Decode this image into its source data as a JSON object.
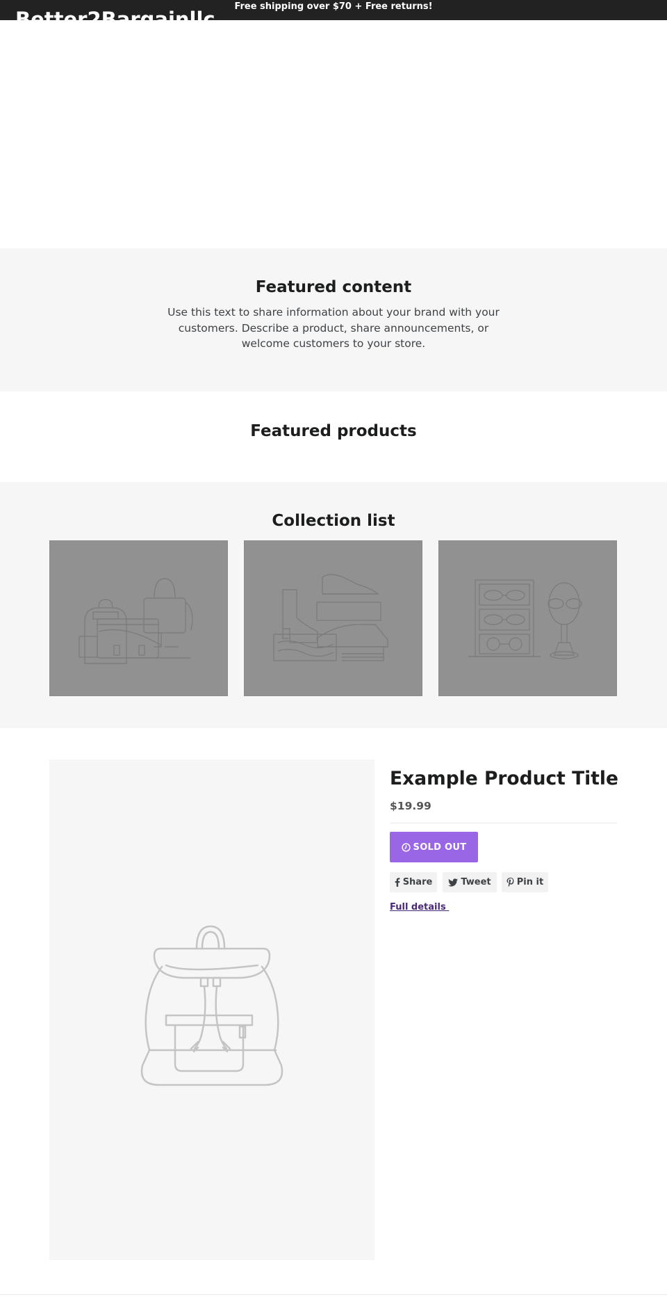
{
  "announcement": {
    "text": "Free shipping over $70 + Free returns!"
  },
  "header": {
    "logo": "Better2Bargainllc"
  },
  "featured_content": {
    "title": "Featured content",
    "body": "Use this text to share information about your brand with your customers. Describe a product, share announcements, or welcome customers to your store."
  },
  "featured_products": {
    "title": "Featured products"
  },
  "collection_list": {
    "title": "Collection list",
    "items": [
      {
        "icon": "bags-collection-icon"
      },
      {
        "icon": "shoes-collection-icon"
      },
      {
        "icon": "glasses-collection-icon"
      }
    ]
  },
  "product": {
    "image_icon": "backpack-icon",
    "title": "Example Product Title",
    "price": "$19.99",
    "sold_out_label": "SOLD OUT",
    "share_buttons": [
      {
        "label": "Share",
        "icon": "facebook-icon"
      },
      {
        "label": "Tweet",
        "icon": "twitter-icon"
      },
      {
        "label": "Pin it",
        "icon": "pinterest-icon"
      }
    ],
    "full_details": "Full details "
  },
  "colors": {
    "announcement_bg": "#222222",
    "section_bg": "#f6f6f6",
    "button_accent": "#9966e6",
    "collection_placeholder": "#919191",
    "link": "#4a2a78"
  }
}
